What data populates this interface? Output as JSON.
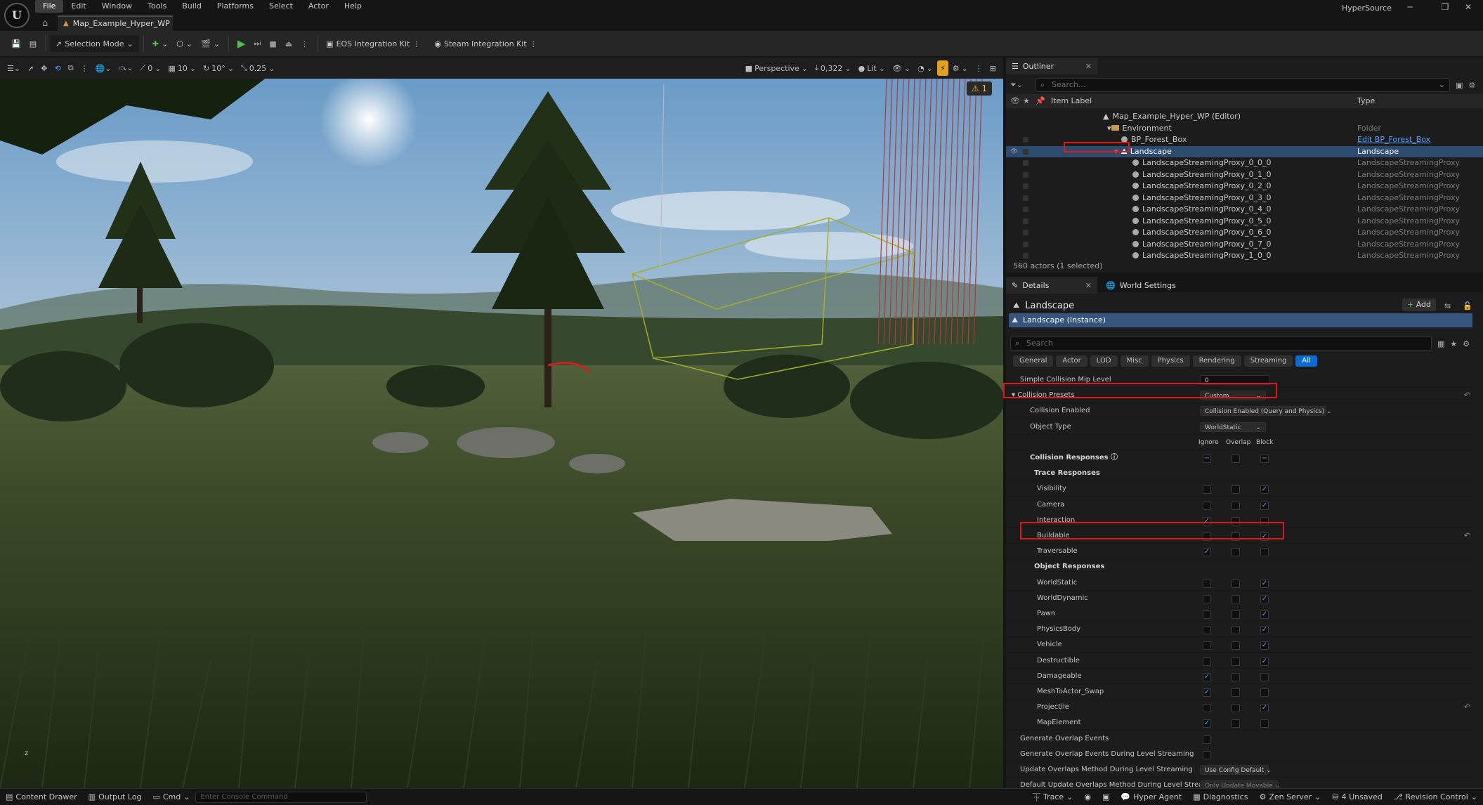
{
  "window": {
    "logo": "U",
    "menus": [
      "File",
      "Edit",
      "Window",
      "Tools",
      "Build",
      "Platforms",
      "Select",
      "Actor",
      "Help"
    ],
    "doc_tab": "Map_Example_Hyper_WP",
    "project": "HyperSource"
  },
  "toolbar": {
    "selection_mode": "Selection Mode",
    "eos": "EOS Integration Kit",
    "steam": "Steam Integration Kit"
  },
  "viewport": {
    "tools": {
      "rotate": "0",
      "grid": "10",
      "angle": "10°",
      "scale": "0.25",
      "perspective": "Perspective",
      "fov": "0,322",
      "lit": "Lit"
    },
    "warning": "1"
  },
  "outliner": {
    "tab": "Outliner",
    "search_placeholder": "Search...",
    "col_label": "Item Label",
    "col_type": "Type",
    "rows": [
      {
        "label": "Map_Example_Hyper_WP (Editor)",
        "type": ""
      },
      {
        "label": "Environment",
        "type": "Folder"
      },
      {
        "label": "BP_Forest_Box",
        "type": "Edit BP_Forest_Box"
      },
      {
        "label": "Landscape",
        "type": "Landscape"
      },
      {
        "label": "LandscapeStreamingProxy_0_0_0",
        "type": "LandscapeStreamingProxy"
      },
      {
        "label": "LandscapeStreamingProxy_0_1_0",
        "type": "LandscapeStreamingProxy"
      },
      {
        "label": "LandscapeStreamingProxy_0_2_0",
        "type": "LandscapeStreamingProxy"
      },
      {
        "label": "LandscapeStreamingProxy_0_3_0",
        "type": "LandscapeStreamingProxy"
      },
      {
        "label": "LandscapeStreamingProxy_0_4_0",
        "type": "LandscapeStreamingProxy"
      },
      {
        "label": "LandscapeStreamingProxy_0_5_0",
        "type": "LandscapeStreamingProxy"
      },
      {
        "label": "LandscapeStreamingProxy_0_6_0",
        "type": "LandscapeStreamingProxy"
      },
      {
        "label": "LandscapeStreamingProxy_0_7_0",
        "type": "LandscapeStreamingProxy"
      },
      {
        "label": "LandscapeStreamingProxy_1_0_0",
        "type": "LandscapeStreamingProxy"
      }
    ],
    "actor_count": "560 actors (1 selected)"
  },
  "details": {
    "tab": "Details",
    "world_tab": "World Settings",
    "title": "Landscape",
    "add": "Add",
    "instance": "Landscape (Instance)",
    "search_placeholder": "Search",
    "filters": [
      "General",
      "Actor",
      "LOD",
      "Misc",
      "Physics",
      "Rendering",
      "Streaming",
      "All"
    ],
    "simple_collision_label": "Simple Collision Mip Level",
    "simple_collision_value": "0",
    "collision_presets_label": "Collision Presets",
    "collision_presets_value": "Custom...",
    "collision_enabled_label": "Collision Enabled",
    "collision_enabled_value": "Collision Enabled (Query and Physics)",
    "object_type_label": "Object Type",
    "object_type_value": "WorldStatic",
    "col_ignore": "Ignore",
    "col_overlap": "Overlap",
    "col_block": "Block",
    "collision_responses": "Collision Responses",
    "trace_responses": "Trace Responses",
    "object_responses": "Object Responses",
    "trace_rows": [
      {
        "name": "Visibility",
        "state": "block"
      },
      {
        "name": "Camera",
        "state": "block"
      },
      {
        "name": "Interaction",
        "state": "ignore"
      },
      {
        "name": "Buildable",
        "state": "block"
      },
      {
        "name": "Traversable",
        "state": "ignore"
      }
    ],
    "object_rows": [
      {
        "name": "WorldStatic",
        "state": "block"
      },
      {
        "name": "WorldDynamic",
        "state": "block"
      },
      {
        "name": "Pawn",
        "state": "block"
      },
      {
        "name": "PhysicsBody",
        "state": "block"
      },
      {
        "name": "Vehicle",
        "state": "block"
      },
      {
        "name": "Destructible",
        "state": "block"
      },
      {
        "name": "Damageable",
        "state": "ignore"
      },
      {
        "name": "MeshToActor_Swap",
        "state": "ignore"
      },
      {
        "name": "Projectile",
        "state": "block"
      },
      {
        "name": "MapElement",
        "state": "ignore"
      }
    ],
    "gen_overlap": "Generate Overlap Events",
    "gen_overlap_stream": "Generate Overlap Events During Level Streaming",
    "update_overlap": "Update Overlaps Method During Level Streaming",
    "update_overlap_value": "Use Config Default",
    "default_update_overlap": "Default Update Overlaps Method During Level Streaming",
    "default_update_overlap_value": "Only Update Movable"
  },
  "statusbar": {
    "content_drawer": "Content Drawer",
    "output_log": "Output Log",
    "cmd": "Cmd",
    "console_placeholder": "Enter Console Command",
    "trace": "Trace",
    "hyper_agent": "Hyper Agent",
    "diagnostics": "Diagnostics",
    "zen": "Zen Server",
    "unsaved": "4 Unsaved",
    "revision": "Revision Control"
  },
  "colors": {
    "accent": "#0a6ad6",
    "selection": "#2d4a6f",
    "highlight_box": "#e01818",
    "play": "#4ec24e"
  }
}
